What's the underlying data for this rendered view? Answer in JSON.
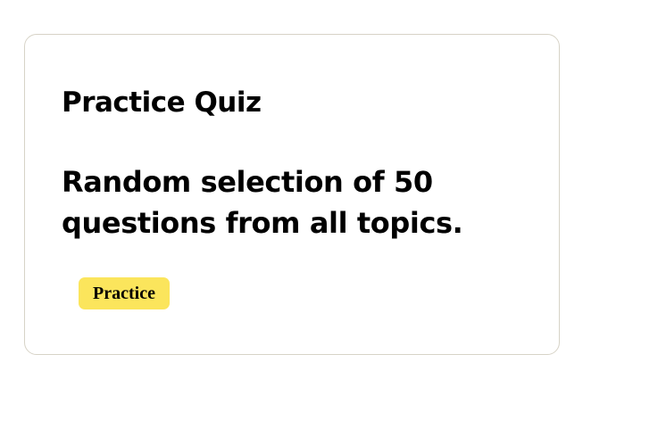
{
  "card": {
    "title": "Practice Quiz",
    "description": "Random selection of 50 questions from all topics.",
    "badge_label": "Practice"
  },
  "colors": {
    "card_border": "#d7d3c7",
    "badge_background": "#fbe55c",
    "text": "#000000"
  }
}
